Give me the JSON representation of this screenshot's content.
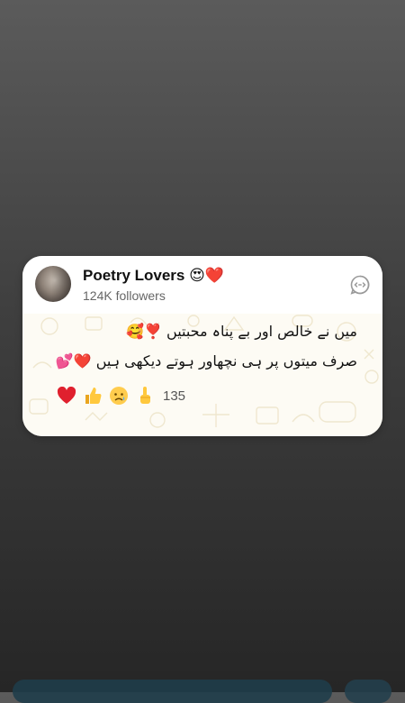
{
  "channel": {
    "name": "Poetry Lovers",
    "name_emoji": "😍❤️",
    "followers": "124K followers"
  },
  "message": {
    "line1": "میں نے خالص اور بے پناہ محبتیں",
    "line1_emoji": "❣️🥰",
    "line2": "صرف میتوں پر ہی نچھاور ہوتے دیکھی ہیں",
    "line2_emoji": "❤️💕"
  },
  "reactions": {
    "items": [
      {
        "icon": "red-heart-icon"
      },
      {
        "icon": "thumbs-up-icon"
      },
      {
        "icon": "sad-face-icon"
      },
      {
        "icon": "raised-finger-icon"
      }
    ],
    "count": "135"
  },
  "colors": {
    "background_top": "#5b5b5b",
    "background_bottom": "#262626",
    "card": "#ffffff",
    "card_body": "#fdfbf4"
  }
}
